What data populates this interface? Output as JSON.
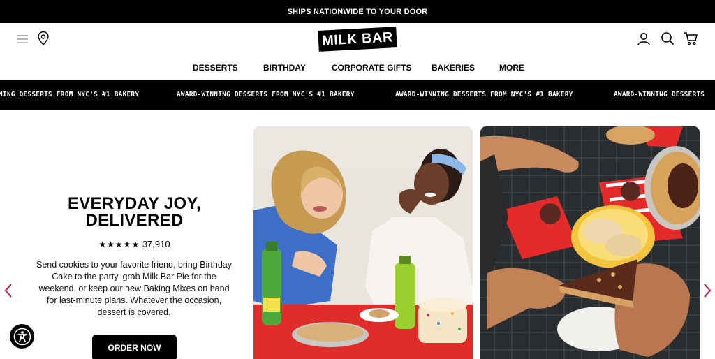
{
  "announcement": "SHIPS NATIONWIDE TO YOUR DOOR",
  "logo_text": "MILK BAR",
  "header_icons": {
    "left": [
      "menu-icon",
      "location-icon"
    ],
    "right": [
      "account-icon",
      "search-icon",
      "cart-icon"
    ]
  },
  "nav": {
    "items": [
      {
        "label": "DESSERTS"
      },
      {
        "label": "BIRTHDAY"
      },
      {
        "label": "CORPORATE GIFTS"
      },
      {
        "label": "BAKERIES"
      },
      {
        "label": "MORE"
      }
    ]
  },
  "marquee": {
    "items": [
      "NING DESSERTS FROM NYC'S #1 BAKERY",
      "AWARD-WINNING DESSERTS FROM NYC'S #1 BAKERY",
      "AWARD-WINNING DESSERTS FROM NYC'S #1 BAKERY",
      "AWARD-WINNING DESSERTS"
    ]
  },
  "hero": {
    "headline_line1": "EVERYDAY JOY,",
    "headline_line2": "DELIVERED",
    "stars": "★★★★★",
    "rating_count": "37,910",
    "description": "Send cookies to your favorite friend, bring Birthday Cake to the party, grab Milk Bar Pie for the weekend, or keep our new Baking Mixes on hand for last-minute plans. Whatever the occasion, dessert is covered.",
    "cta_label": "ORDER NOW"
  },
  "colors": {
    "accent": "#c0245a",
    "black": "#000000",
    "white": "#ffffff"
  }
}
